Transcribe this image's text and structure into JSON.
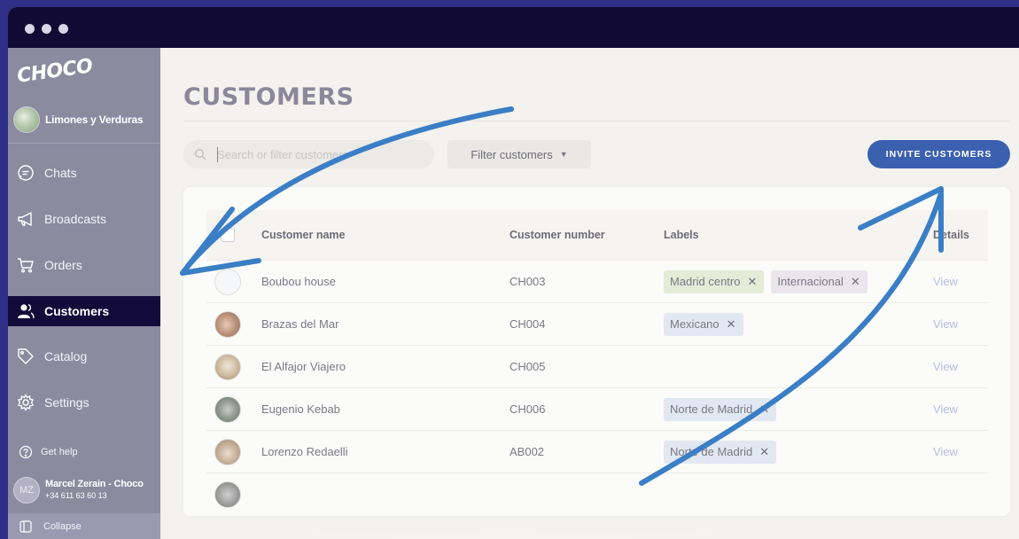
{
  "brand": {
    "logo": "CHOCO",
    "accent": "#3b60b0",
    "sidebar_bg": "#8c8a9f",
    "active_bg": "#120b3a"
  },
  "org": {
    "name": "Limones y Verduras"
  },
  "sidebar": {
    "items": [
      {
        "label": "Chats",
        "icon": "chat-bubble-icon"
      },
      {
        "label": "Broadcasts",
        "icon": "megaphone-icon"
      },
      {
        "label": "Orders",
        "icon": "cart-icon"
      },
      {
        "label": "Customers",
        "icon": "users-icon",
        "active": true
      },
      {
        "label": "Catalog",
        "icon": "tag-icon"
      },
      {
        "label": "Settings",
        "icon": "gear-icon"
      }
    ],
    "get_help": "Get help",
    "collapse": "Collapse"
  },
  "user": {
    "initials": "MZ",
    "name": "Marcel Zerain - Choco",
    "phone": "+34 611 63 60 13"
  },
  "main": {
    "title": "CUSTOMERS",
    "search_placeholder": "Search or filter customers",
    "filter_label": "Filter customers",
    "invite_label": "INVITE CUSTOMERS"
  },
  "table": {
    "columns": [
      "Customer name",
      "Customer number",
      "Labels",
      "Details"
    ],
    "rows": [
      {
        "name": "Boubou house",
        "number": "CH003",
        "labels": [
          {
            "text": "Madrid centro",
            "color": "#e4ecd8"
          },
          {
            "text": "Internacional",
            "color": "#ebe6ec"
          }
        ],
        "details": "View"
      },
      {
        "name": "Brazas del Mar",
        "number": "CH004",
        "labels": [
          {
            "text": "Mexicano",
            "color": "#e2e8f1"
          }
        ],
        "details": "View"
      },
      {
        "name": "El Alfajor Viajero",
        "number": "CH005",
        "labels": [],
        "details": "View"
      },
      {
        "name": "Eugenio Kebab",
        "number": "CH006",
        "labels": [
          {
            "text": "Norte de Madrid",
            "color": "#e2e8f1"
          }
        ],
        "details": "View"
      },
      {
        "name": "Lorenzo Redaelli",
        "number": "AB002",
        "labels": [
          {
            "text": "Norte de Madrid",
            "color": "#e2e8f1"
          }
        ],
        "details": "View"
      }
    ]
  }
}
